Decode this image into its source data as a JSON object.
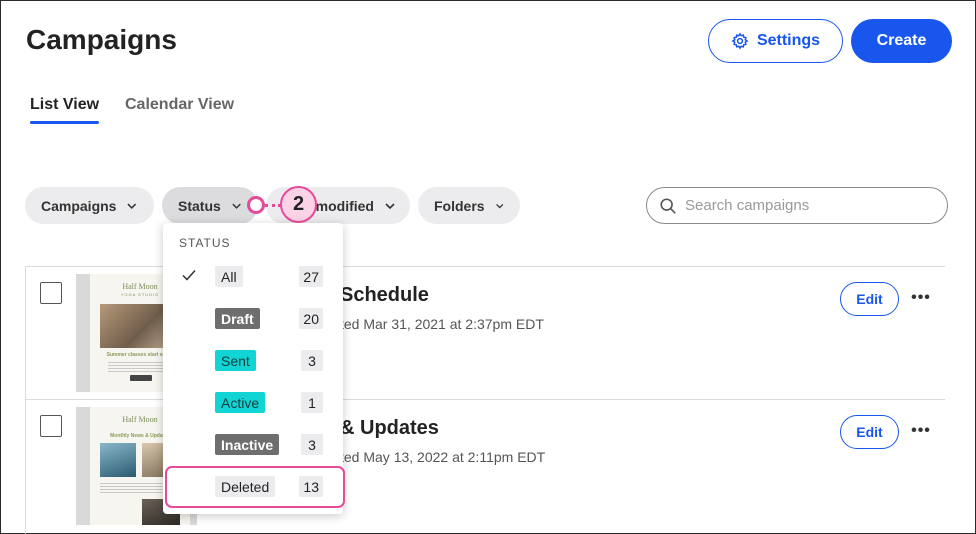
{
  "header": {
    "title": "Campaigns",
    "settings_label": "Settings",
    "create_label": "Create"
  },
  "tabs": [
    {
      "label": "List View",
      "active": true
    },
    {
      "label": "Calendar View",
      "active": false
    }
  ],
  "filters": {
    "campaigns_label": "Campaigns",
    "status_label": "Status",
    "modified_label": "modified",
    "folders_label": "Folders"
  },
  "search": {
    "placeholder": "Search campaigns",
    "value": ""
  },
  "callout": {
    "number": "2",
    "color": "#e64a9b"
  },
  "status_dropdown": {
    "heading": "STATUS",
    "items": [
      {
        "label": "All",
        "count": "27",
        "checked": true
      },
      {
        "label": "Draft",
        "count": "20",
        "checked": false
      },
      {
        "label": "Sent",
        "count": "3",
        "checked": false
      },
      {
        "label": "Active",
        "count": "1",
        "checked": false
      },
      {
        "label": "Inactive",
        "count": "3",
        "checked": false
      },
      {
        "label": "Deleted",
        "count": "13",
        "checked": false,
        "highlighted": true
      }
    ]
  },
  "campaigns": [
    {
      "title": "Schedule",
      "meta": "ted Mar 31, 2021 at 2:37pm EDT",
      "thumbnail": {
        "logo": "Half Moon",
        "subtitle": "YOGA STUDIO",
        "caption": "Summer classes start soon!"
      },
      "edit_label": "Edit",
      "more_label": "•••"
    },
    {
      "title": "& Updates",
      "meta": "ted May 13, 2022 at 2:11pm EDT",
      "thumbnail": {
        "logo": "Half Moon",
        "caption": "Monthly News & Updates"
      },
      "edit_label": "Edit",
      "more_label": "•••"
    }
  ],
  "colors": {
    "accent": "#1856ed",
    "highlight": "#e64a9b",
    "teal_badge": "#12d4d4",
    "gray_badge": "#6e6e6e"
  }
}
